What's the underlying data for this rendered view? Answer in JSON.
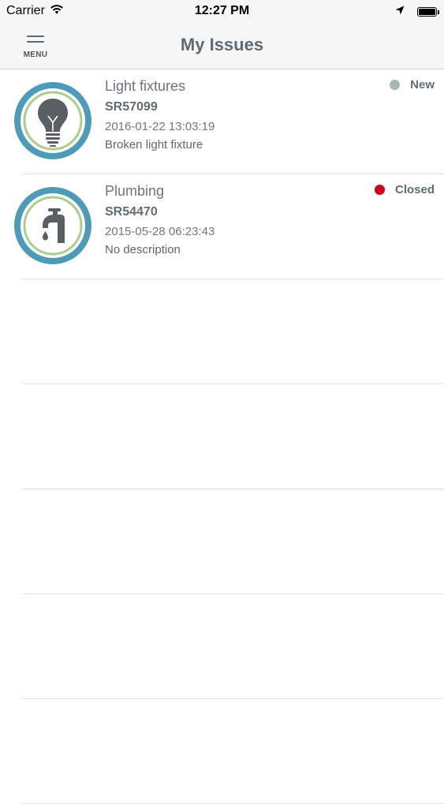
{
  "status_bar": {
    "carrier": "Carrier",
    "time": "12:27 PM"
  },
  "nav": {
    "menu_label": "MENU",
    "title": "My Issues"
  },
  "issues": [
    {
      "category": "Light fixtures",
      "id": "SR57099",
      "date": "2016-01-22 13:03:19",
      "description": "Broken light fixture",
      "status": "New",
      "status_color": "#a7b8b3",
      "icon": "lightbulb-icon"
    },
    {
      "category": "Plumbing",
      "id": "SR54470",
      "date": "2015-05-28 06:23:43",
      "description": "No description",
      "status": "Closed",
      "status_color": "#d0021b",
      "icon": "faucet-icon"
    }
  ],
  "colors": {
    "ring_outer": "#4e9bb7",
    "ring_inner": "#a9cf8c",
    "icon_fill": "#5a5f63"
  }
}
